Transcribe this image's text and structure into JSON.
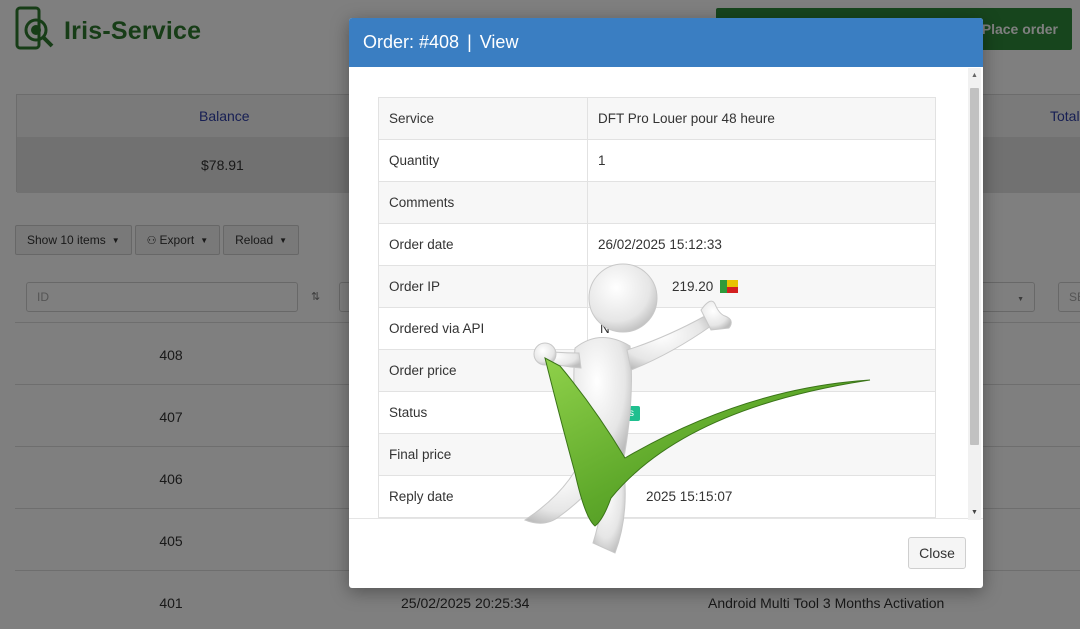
{
  "brand": {
    "name": "Iris-Service"
  },
  "header": {
    "place_order_label": "Place order"
  },
  "stats": {
    "balance_label": "Balance",
    "balance_value": "$78.91",
    "total_label": "Total"
  },
  "toolbar": {
    "show_items_label": "Show 10 items",
    "export_label": "Export",
    "reload_label": "Reload"
  },
  "filters": {
    "id_placeholder": "ID",
    "search_placeholder": "SE"
  },
  "orders": [
    {
      "id": "408",
      "date": "",
      "service": ""
    },
    {
      "id": "407",
      "date": "",
      "service": ""
    },
    {
      "id": "406",
      "date": "",
      "service": ""
    },
    {
      "id": "405",
      "date": "",
      "service": ""
    },
    {
      "id": "401",
      "date": "25/02/2025 20:25:34",
      "service": "Android Multi Tool 3 Months Activation"
    }
  ],
  "modal": {
    "title_order": "Order: #408",
    "title_sep": "|",
    "title_view": "View",
    "close_label": "Close",
    "rows": [
      {
        "key": "Service",
        "value": "DFT Pro Louer pour 48 heure"
      },
      {
        "key": "Quantity",
        "value": "1"
      },
      {
        "key": "Comments",
        "value": ""
      },
      {
        "key": "Order date",
        "value": "26/02/2025 15:12:33"
      },
      {
        "key": "Order IP",
        "value": "219.20"
      },
      {
        "key": "Ordered via API",
        "value": "N"
      },
      {
        "key": "Order price",
        "value": ""
      },
      {
        "key": "Status",
        "value": "ss"
      },
      {
        "key": "Final price",
        "value": ""
      },
      {
        "key": "Reply date",
        "value": "2025 15:15:07"
      }
    ]
  },
  "colors": {
    "modal_header": "#3a7ec2",
    "place_order": "#2e8b3a",
    "status_badge": "#1fbf8f",
    "brand_text": "#2f7a2f"
  }
}
